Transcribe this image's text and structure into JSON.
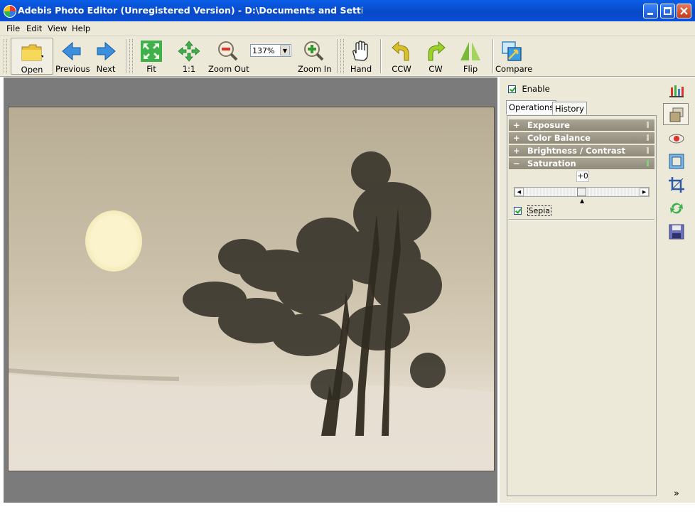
{
  "window": {
    "title": "Adebis Photo Editor (Unregistered Version) - D:\\Documents and Settings\\Julia\\"
  },
  "menu": [
    "File",
    "Edit",
    "View",
    "Help"
  ],
  "toolbar": {
    "open": "Open",
    "previous": "Previous",
    "next": "Next",
    "fit": "Fit",
    "one_to_one": "1:1",
    "zoom_out": "Zoom Out",
    "zoom_value": "137%",
    "zoom_in": "Zoom In",
    "hand": "Hand",
    "ccw": "CCW",
    "cw": "CW",
    "flip": "Flip",
    "compare": "Compare"
  },
  "panel": {
    "enable_label": "Enable",
    "enable_checked": true,
    "tabs": [
      "Operations",
      "History"
    ],
    "active_tab": "Operations",
    "operations": [
      {
        "sign": "+",
        "name": "Exposure",
        "active": false
      },
      {
        "sign": "+",
        "name": "Color Balance",
        "active": false
      },
      {
        "sign": "+",
        "name": "Brightness / Contrast",
        "active": false
      },
      {
        "sign": "−",
        "name": "Saturation",
        "active": true
      }
    ],
    "saturation_value": "+0",
    "sepia_label": "Sepia",
    "sepia_checked": true
  },
  "side_tools": [
    "histogram-icon",
    "layers-icon",
    "red-eye-icon",
    "frame-icon",
    "crop-icon",
    "rotate-icon",
    "save-icon"
  ],
  "side_more": "»",
  "colors": {
    "titlebar": "#0a5ee8",
    "chrome": "#ece9d8",
    "canvas_bg": "#7b7b7b",
    "photo_tone": "#c8bea7"
  }
}
